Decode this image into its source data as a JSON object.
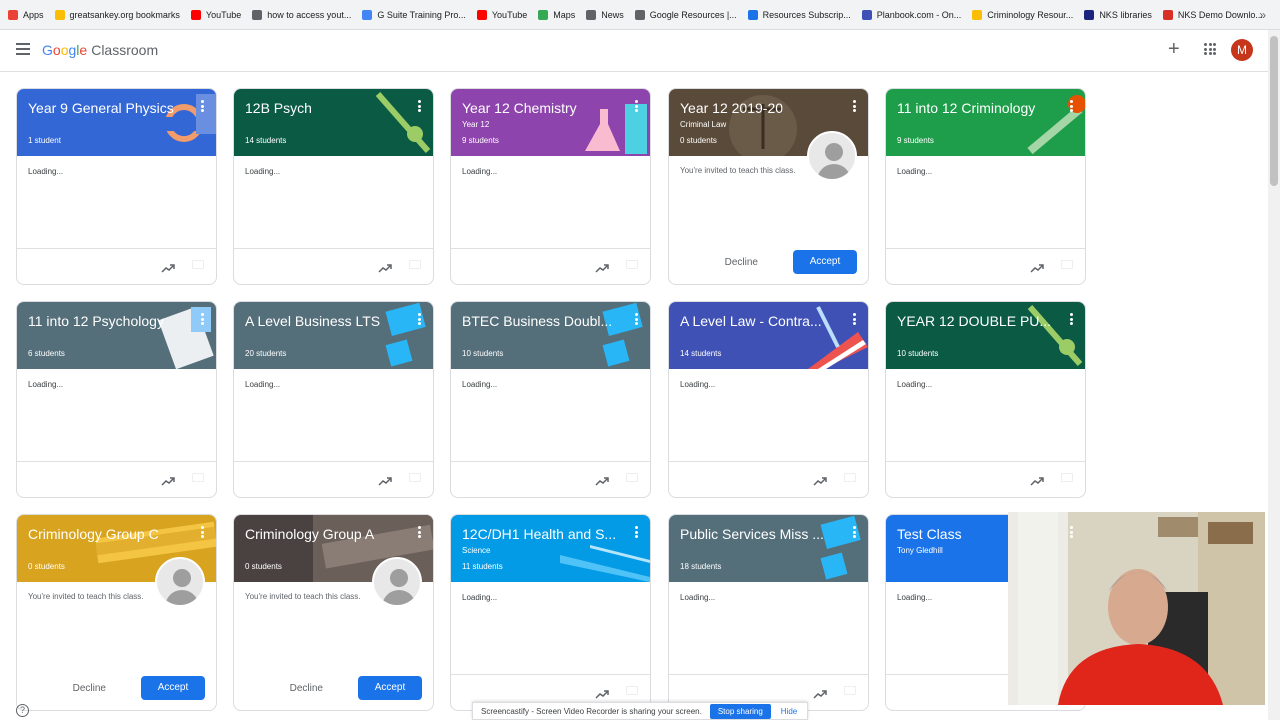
{
  "bookmarks": {
    "items": [
      {
        "label": "Apps",
        "color": "#ea4335"
      },
      {
        "label": "greatsankey.org bookmarks",
        "color": "#fbbc04"
      },
      {
        "label": "YouTube",
        "color": "#ff0000"
      },
      {
        "label": "how to access yout...",
        "color": "#5f6368"
      },
      {
        "label": "G Suite Training Pro...",
        "color": "#4285f4"
      },
      {
        "label": "YouTube",
        "color": "#ff0000"
      },
      {
        "label": "Maps",
        "color": "#34a853"
      },
      {
        "label": "News",
        "color": "#5f6368"
      },
      {
        "label": "Google Resources |...",
        "color": "#5f6368"
      },
      {
        "label": "Resources Subscrip...",
        "color": "#1a73e8"
      },
      {
        "label": "Planbook.com - On...",
        "color": "#3f51b5"
      },
      {
        "label": "Criminology Resour...",
        "color": "#fbbc04"
      },
      {
        "label": "NKS libraries",
        "color": "#1a237e"
      },
      {
        "label": "NKS Demo Downlo...",
        "color": "#d93025"
      }
    ],
    "more": "»"
  },
  "topbar": {
    "logo_google": "Google",
    "logo_classroom": "Classroom",
    "avatar_letter": "M"
  },
  "cards": [
    {
      "title": "Year 9 General Physics",
      "sub": "",
      "count": "1 student",
      "color": "#3367d6",
      "type": "normal",
      "body": "Loading..."
    },
    {
      "title": "12B Psych",
      "sub": "",
      "count": "14 students",
      "color": "#0b5b44",
      "type": "normal",
      "body": "Loading..."
    },
    {
      "title": "Year 12 Chemistry",
      "sub": "Year 12",
      "count": "9 students",
      "color": "#8e44ad",
      "type": "normal",
      "body": "Loading..."
    },
    {
      "title": "Year 12 2019-20",
      "sub": "Criminal Law",
      "count": "0 students",
      "color": "#5a4a3a",
      "type": "invite",
      "body": "You're invited to teach this class."
    },
    {
      "title": "11 into 12 Criminology",
      "sub": "",
      "count": "9 students",
      "color": "#1e9e4a",
      "type": "normal",
      "body": "Loading..."
    },
    {
      "title": "11 into 12 Psychology",
      "sub": "",
      "count": "6 students",
      "color": "#546e7a",
      "type": "normal",
      "body": "Loading..."
    },
    {
      "title": "A Level Business LTS",
      "sub": "",
      "count": "20 students",
      "color": "#546e7a",
      "type": "normal",
      "body": "Loading..."
    },
    {
      "title": "BTEC Business Doubl...",
      "sub": "",
      "count": "10 students",
      "color": "#546e7a",
      "type": "normal",
      "body": "Loading..."
    },
    {
      "title": "A Level Law - Contra...",
      "sub": "",
      "count": "14 students",
      "color": "#3f51b5",
      "type": "normal",
      "body": "Loading..."
    },
    {
      "title": "YEAR 12 DOUBLE PU...",
      "sub": "",
      "count": "10 students",
      "color": "#0b5b44",
      "type": "normal",
      "body": "Loading..."
    },
    {
      "title": "Criminology Group C",
      "sub": "",
      "count": "0 students",
      "color": "#d8a31f",
      "type": "invite",
      "body": "You're invited to teach this class."
    },
    {
      "title": "Criminology Group A",
      "sub": "",
      "count": "0 students",
      "color": "#4a4240",
      "type": "invite",
      "body": "You're invited to teach this class."
    },
    {
      "title": "12C/DH1 Health and S...",
      "sub": "Science",
      "count": "11 students",
      "color": "#039be5",
      "type": "normal",
      "body": "Loading..."
    },
    {
      "title": "Public Services Miss ...",
      "sub": "",
      "count": "18 students",
      "color": "#546e7a",
      "type": "normal",
      "body": "Loading..."
    },
    {
      "title": "Test Class",
      "sub": "Tony Gledhill",
      "count": "",
      "color": "#1a73e8",
      "type": "normal",
      "body": "Loading..."
    }
  ],
  "invite_actions": {
    "decline": "Decline",
    "accept": "Accept"
  },
  "share_bar": {
    "text": "Screencastify - Screen Video Recorder is sharing your screen.",
    "stop": "Stop sharing",
    "hide": "Hide"
  },
  "help": "?"
}
